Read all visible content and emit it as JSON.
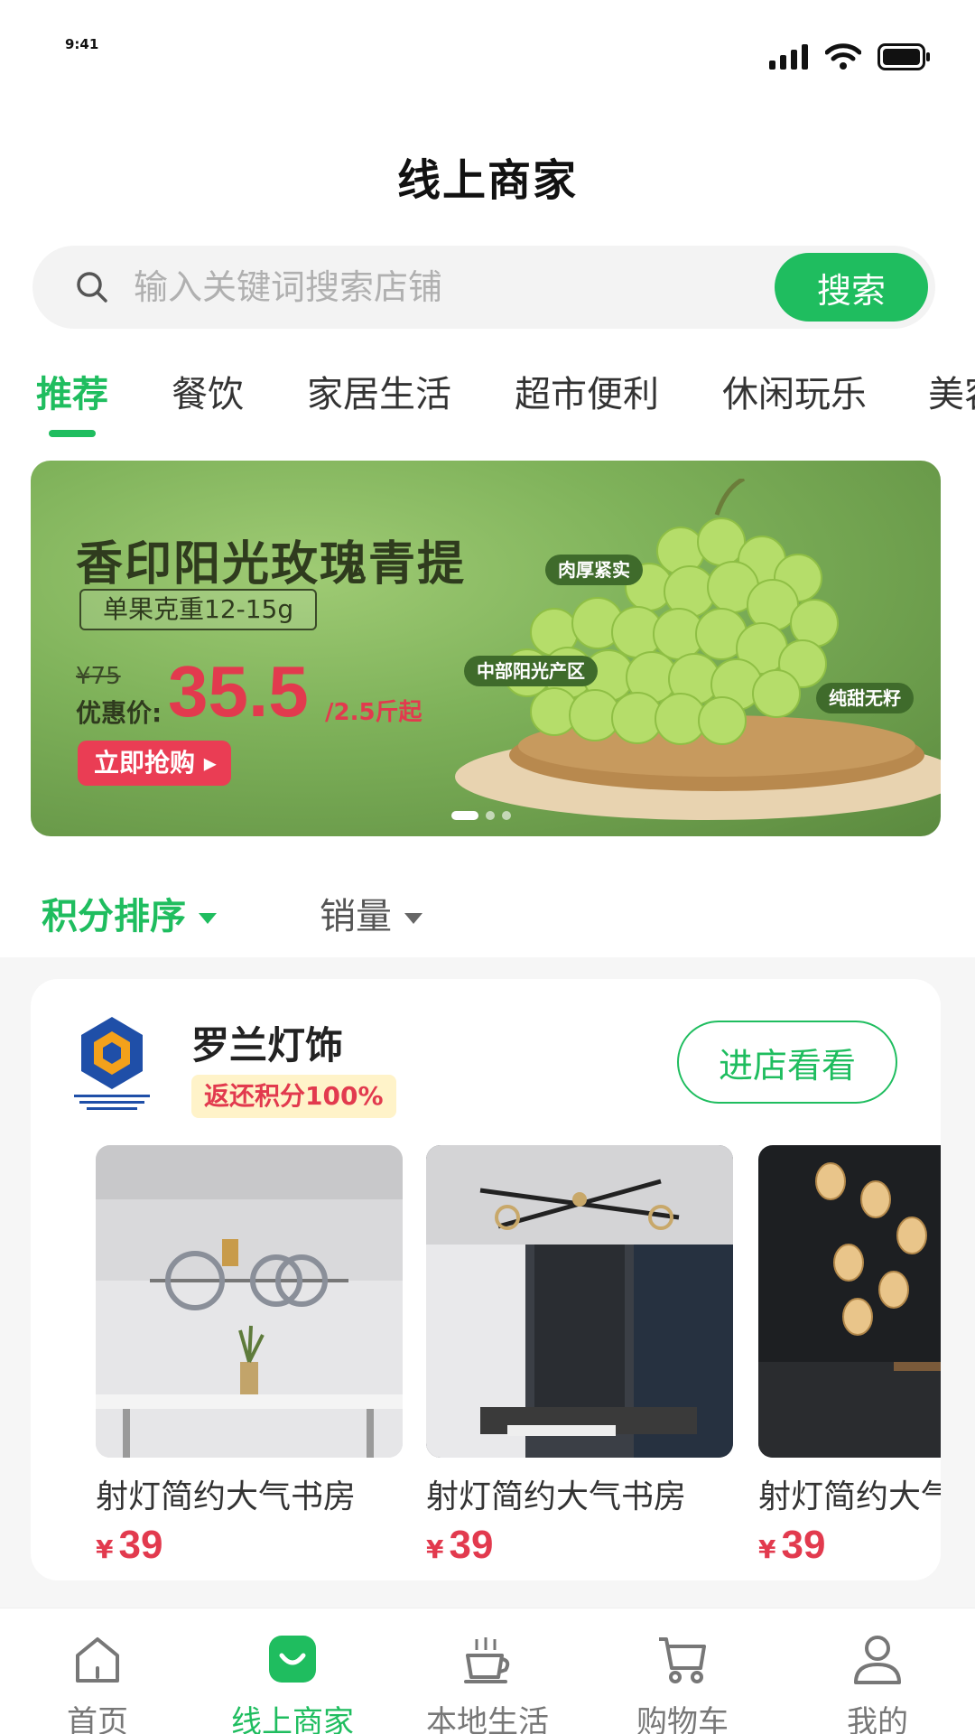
{
  "status_bar": {
    "time": "9:41"
  },
  "page": {
    "title": "线上商家"
  },
  "search": {
    "placeholder": "输入关键词搜索店铺",
    "button_label": "搜索"
  },
  "tabs": [
    {
      "label": "推荐",
      "active": true
    },
    {
      "label": "餐饮"
    },
    {
      "label": "家居生活"
    },
    {
      "label": "超市便利"
    },
    {
      "label": "休闲玩乐"
    },
    {
      "label": "美容"
    }
  ],
  "banner": {
    "title": "香印阳光玫瑰青提",
    "weight": "单果克重12-15g",
    "original_price": "¥75",
    "price_label": "优惠价:",
    "price": "35.5",
    "unit": "/2.5斤起",
    "buy_label": "立即抢购 ▸",
    "tags": [
      "肉厚紧实",
      "中部阳光产区",
      "纯甜无籽"
    ],
    "slide_count": 3,
    "active_slide": 1
  },
  "sort": {
    "points_label": "积分排序",
    "sales_label": "销量"
  },
  "store": {
    "name": "罗兰灯饰",
    "badge": "返还积分100%",
    "enter_label": "进店看看",
    "products": [
      {
        "name": "射灯简约大气书房",
        "currency": "¥",
        "price": "39"
      },
      {
        "name": "射灯简约大气书房",
        "currency": "¥",
        "price": "39"
      },
      {
        "name": "射灯简约大气书房",
        "currency": "¥",
        "price": "39"
      }
    ]
  },
  "bottom_nav": [
    {
      "label": "首页",
      "icon": "home-icon"
    },
    {
      "label": "线上商家",
      "icon": "shopping-bag-icon",
      "active": true
    },
    {
      "label": "本地生活",
      "icon": "coffee-cup-icon"
    },
    {
      "label": "购物车",
      "icon": "cart-icon"
    },
    {
      "label": "我的",
      "icon": "profile-icon"
    }
  ],
  "colors": {
    "accent": "#1fbd5f",
    "price_red": "#e23a4e",
    "badge_bg": "#fff3c9"
  }
}
